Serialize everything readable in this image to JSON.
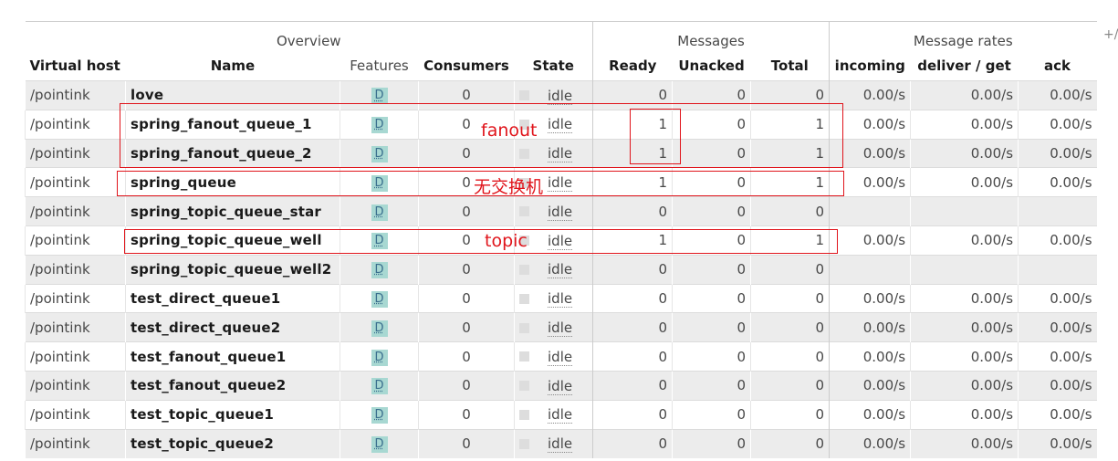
{
  "header": {
    "groups": {
      "overview": "Overview",
      "messages": "Messages",
      "message_rates": "Message rates"
    },
    "plus_minus": "+/-",
    "columns": {
      "vhost": "Virtual host",
      "name": "Name",
      "features": "Features",
      "consumers": "Consumers",
      "state": "State",
      "ready": "Ready",
      "unacked": "Unacked",
      "total": "Total",
      "incoming": "incoming",
      "deliver_get": "deliver / get",
      "ack": "ack"
    }
  },
  "rows": [
    {
      "vhost": "/pointink",
      "name": "love",
      "feature": "D",
      "consumers": "0",
      "state": "idle",
      "ready": "0",
      "unacked": "0",
      "total": "0",
      "incoming": "0.00/s",
      "deliver_get": "0.00/s",
      "ack": "0.00/s"
    },
    {
      "vhost": "/pointink",
      "name": "spring_fanout_queue_1",
      "feature": "D",
      "consumers": "0",
      "state": "idle",
      "ready": "1",
      "unacked": "0",
      "total": "1",
      "incoming": "0.00/s",
      "deliver_get": "0.00/s",
      "ack": "0.00/s"
    },
    {
      "vhost": "/pointink",
      "name": "spring_fanout_queue_2",
      "feature": "D",
      "consumers": "0",
      "state": "idle",
      "ready": "1",
      "unacked": "0",
      "total": "1",
      "incoming": "0.00/s",
      "deliver_get": "0.00/s",
      "ack": "0.00/s"
    },
    {
      "vhost": "/pointink",
      "name": "spring_queue",
      "feature": "D",
      "consumers": "0",
      "state": "idle",
      "ready": "1",
      "unacked": "0",
      "total": "1",
      "incoming": "0.00/s",
      "deliver_get": "0.00/s",
      "ack": "0.00/s"
    },
    {
      "vhost": "/pointink",
      "name": "spring_topic_queue_star",
      "feature": "D",
      "consumers": "0",
      "state": "idle",
      "ready": "0",
      "unacked": "0",
      "total": "0",
      "incoming": "",
      "deliver_get": "",
      "ack": ""
    },
    {
      "vhost": "/pointink",
      "name": "spring_topic_queue_well",
      "feature": "D",
      "consumers": "0",
      "state": "idle",
      "ready": "1",
      "unacked": "0",
      "total": "1",
      "incoming": "0.00/s",
      "deliver_get": "0.00/s",
      "ack": "0.00/s"
    },
    {
      "vhost": "/pointink",
      "name": "spring_topic_queue_well2",
      "feature": "D",
      "consumers": "0",
      "state": "idle",
      "ready": "0",
      "unacked": "0",
      "total": "0",
      "incoming": "",
      "deliver_get": "",
      "ack": ""
    },
    {
      "vhost": "/pointink",
      "name": "test_direct_queue1",
      "feature": "D",
      "consumers": "0",
      "state": "idle",
      "ready": "0",
      "unacked": "0",
      "total": "0",
      "incoming": "0.00/s",
      "deliver_get": "0.00/s",
      "ack": "0.00/s"
    },
    {
      "vhost": "/pointink",
      "name": "test_direct_queue2",
      "feature": "D",
      "consumers": "0",
      "state": "idle",
      "ready": "0",
      "unacked": "0",
      "total": "0",
      "incoming": "0.00/s",
      "deliver_get": "0.00/s",
      "ack": "0.00/s"
    },
    {
      "vhost": "/pointink",
      "name": "test_fanout_queue1",
      "feature": "D",
      "consumers": "0",
      "state": "idle",
      "ready": "0",
      "unacked": "0",
      "total": "0",
      "incoming": "0.00/s",
      "deliver_get": "0.00/s",
      "ack": "0.00/s"
    },
    {
      "vhost": "/pointink",
      "name": "test_fanout_queue2",
      "feature": "D",
      "consumers": "0",
      "state": "idle",
      "ready": "0",
      "unacked": "0",
      "total": "0",
      "incoming": "0.00/s",
      "deliver_get": "0.00/s",
      "ack": "0.00/s"
    },
    {
      "vhost": "/pointink",
      "name": "test_topic_queue1",
      "feature": "D",
      "consumers": "0",
      "state": "idle",
      "ready": "0",
      "unacked": "0",
      "total": "0",
      "incoming": "0.00/s",
      "deliver_get": "0.00/s",
      "ack": "0.00/s"
    },
    {
      "vhost": "/pointink",
      "name": "test_topic_queue2",
      "feature": "D",
      "consumers": "0",
      "state": "idle",
      "ready": "0",
      "unacked": "0",
      "total": "0",
      "incoming": "0.00/s",
      "deliver_get": "0.00/s",
      "ack": "0.00/s"
    }
  ],
  "annotations": {
    "fanout_label": "fanout",
    "no_exchange_label": "无交换机",
    "topic_label": "topic",
    "color": "#e0141b"
  }
}
